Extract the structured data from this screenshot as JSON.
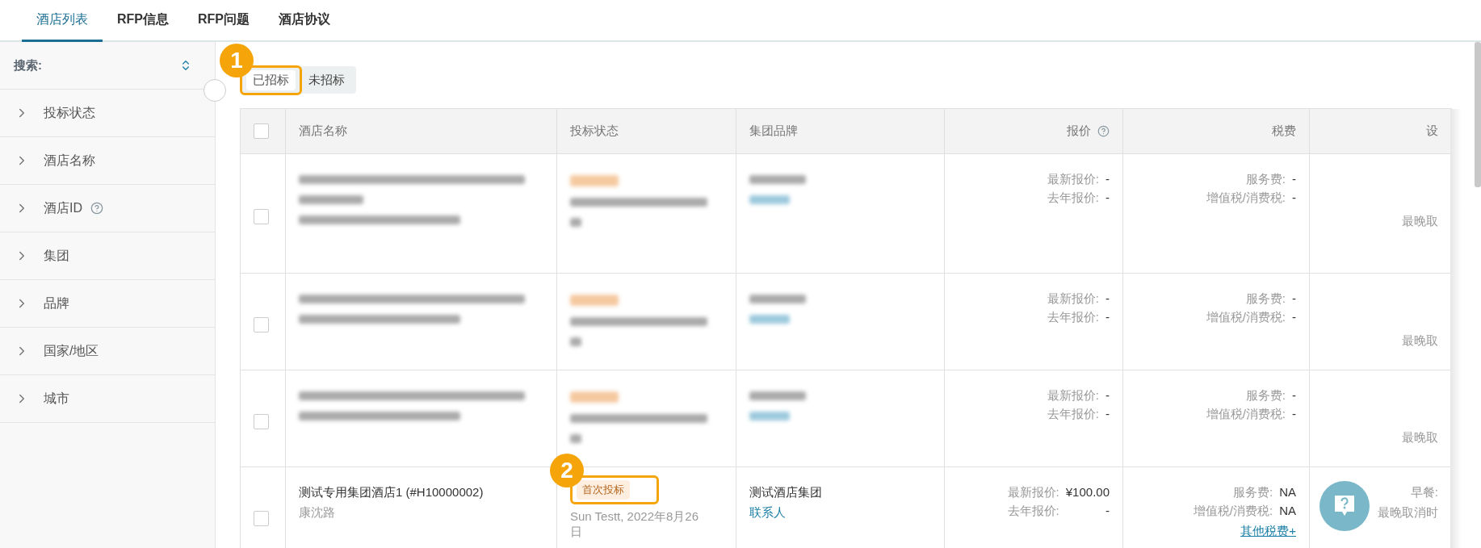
{
  "tabs": [
    {
      "label": "酒店列表",
      "selected": true
    },
    {
      "label": "RFP信息",
      "selected": false
    },
    {
      "label": "RFP问题",
      "selected": false
    },
    {
      "label": "酒店协议",
      "selected": false
    }
  ],
  "sidebar": {
    "search_label": "搜索:",
    "filters": [
      {
        "label": "投标状态",
        "help": false
      },
      {
        "label": "酒店名称",
        "help": false
      },
      {
        "label": "酒店ID",
        "help": true
      },
      {
        "label": "集团",
        "help": false
      },
      {
        "label": "品牌",
        "help": false
      },
      {
        "label": "国家/地区",
        "help": false
      },
      {
        "label": "城市",
        "help": false
      }
    ]
  },
  "segments": [
    {
      "label": "已招标",
      "selected": true,
      "annotation": "1"
    },
    {
      "label": "未招标",
      "selected": false
    }
  ],
  "table": {
    "select_all_checked": false,
    "columns": [
      {
        "label": "酒店名称",
        "help": false
      },
      {
        "label": "投标状态",
        "help": false
      },
      {
        "label": "集团品牌",
        "help": false
      },
      {
        "label": "报价",
        "help": true
      },
      {
        "label": "税费",
        "help": false
      },
      {
        "label": "设",
        "help": false
      }
    ],
    "rows": [
      {
        "redacted": true,
        "checked": false,
        "price": {
          "latest_label": "最新报价:",
          "latest": "-",
          "last_label": "去年报价:",
          "last": "-"
        },
        "tax": {
          "service_label": "服务费:",
          "service": "-",
          "vat_label": "增值税/消费税:",
          "vat": "-"
        },
        "extra": [
          "最晚取"
        ]
      },
      {
        "redacted": true,
        "checked": false,
        "price": {
          "latest_label": "最新报价:",
          "latest": "-",
          "last_label": "去年报价:",
          "last": "-"
        },
        "tax": {
          "service_label": "服务费:",
          "service": "-",
          "vat_label": "增值税/消费税:",
          "vat": "-"
        },
        "extra": [
          "最晚取"
        ]
      },
      {
        "redacted": true,
        "checked": false,
        "price": {
          "latest_label": "最新报价:",
          "latest": "-",
          "last_label": "去年报价:",
          "last": "-"
        },
        "tax": {
          "service_label": "服务费:",
          "service": "-",
          "vat_label": "增值税/消费税:",
          "vat": "-"
        },
        "extra": [
          "最晚取"
        ]
      },
      {
        "redacted": false,
        "checked": false,
        "name": "测试专用集团酒店1 (#H10000002)",
        "address": "康沈路",
        "status": {
          "tag": "首次投标",
          "annotation": "2",
          "by": "Sun Testt, 2022年8月26日"
        },
        "brand": "测试酒店集团",
        "contact": "联系人",
        "price": {
          "latest_label": "最新报价:",
          "latest": "¥100.00",
          "last_label": "去年报价:",
          "last": "-"
        },
        "tax": {
          "service_label": "服务费:",
          "service": "NA",
          "vat_label": "增值税/消费税:",
          "vat": "NA",
          "other_link": "其他税费+"
        },
        "extra": [
          "早餐:",
          "最晚取消时"
        ]
      }
    ]
  }
}
